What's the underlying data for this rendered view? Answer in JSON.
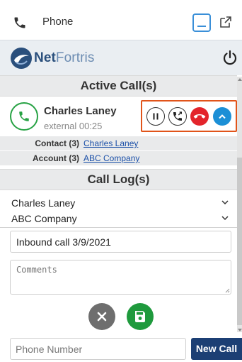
{
  "window": {
    "title": "Phone",
    "icons": {
      "app": "phone-icon",
      "minimize": "minimize-icon",
      "popout": "popout-icon"
    }
  },
  "header": {
    "logo_part1": "Net",
    "logo_part2": "Fortris",
    "icons": {
      "logo": "netfortris-logo-icon",
      "power": "power-icon"
    }
  },
  "active_calls": {
    "heading": "Active Call(s)",
    "call": {
      "caller_name": "Charles Laney",
      "detail": "external 00:25",
      "icons": {
        "status": "phone-call-icon",
        "pause": "pause-icon",
        "transfer": "transfer-icon",
        "hangup": "hangup-icon",
        "expand": "chevron-up-icon"
      },
      "colors": {
        "highlight_border": "#e1541a",
        "hangup": "#e3242b",
        "expand": "#1b8fd6",
        "status": "#27a244"
      }
    },
    "contact": {
      "label": "Contact (3)",
      "value": "Charles Laney"
    },
    "account": {
      "label": "Account (3)",
      "value": "ABC Company"
    }
  },
  "call_log": {
    "heading": "Call Log(s)",
    "contact_select": "Charles Laney",
    "account_select": "ABC Company",
    "subject_value": "Inbound call 3/9/2021",
    "comments_placeholder": "Comments",
    "icons": {
      "cancel": "close-icon",
      "save": "save-icon",
      "select": "chevron-down-icon"
    },
    "colors": {
      "cancel": "#6e6e6e",
      "save": "#1f9a3d"
    }
  },
  "footer": {
    "phone_placeholder": "Phone Number",
    "new_call_label": "New Call",
    "colors": {
      "new_call": "#1c3f74"
    }
  }
}
